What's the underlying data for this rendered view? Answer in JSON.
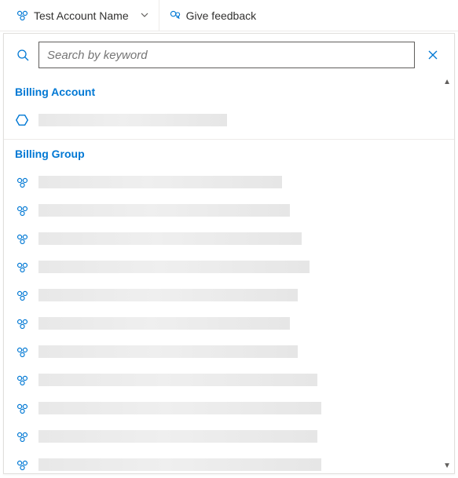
{
  "header": {
    "account_label": "Test Account Name",
    "feedback_label": "Give feedback"
  },
  "search": {
    "placeholder": "Search by keyword",
    "value": ""
  },
  "sections": {
    "billing_account": {
      "title": "Billing Account"
    },
    "billing_group": {
      "title": "Billing Group"
    }
  },
  "colors": {
    "accent": "#0078d4"
  }
}
